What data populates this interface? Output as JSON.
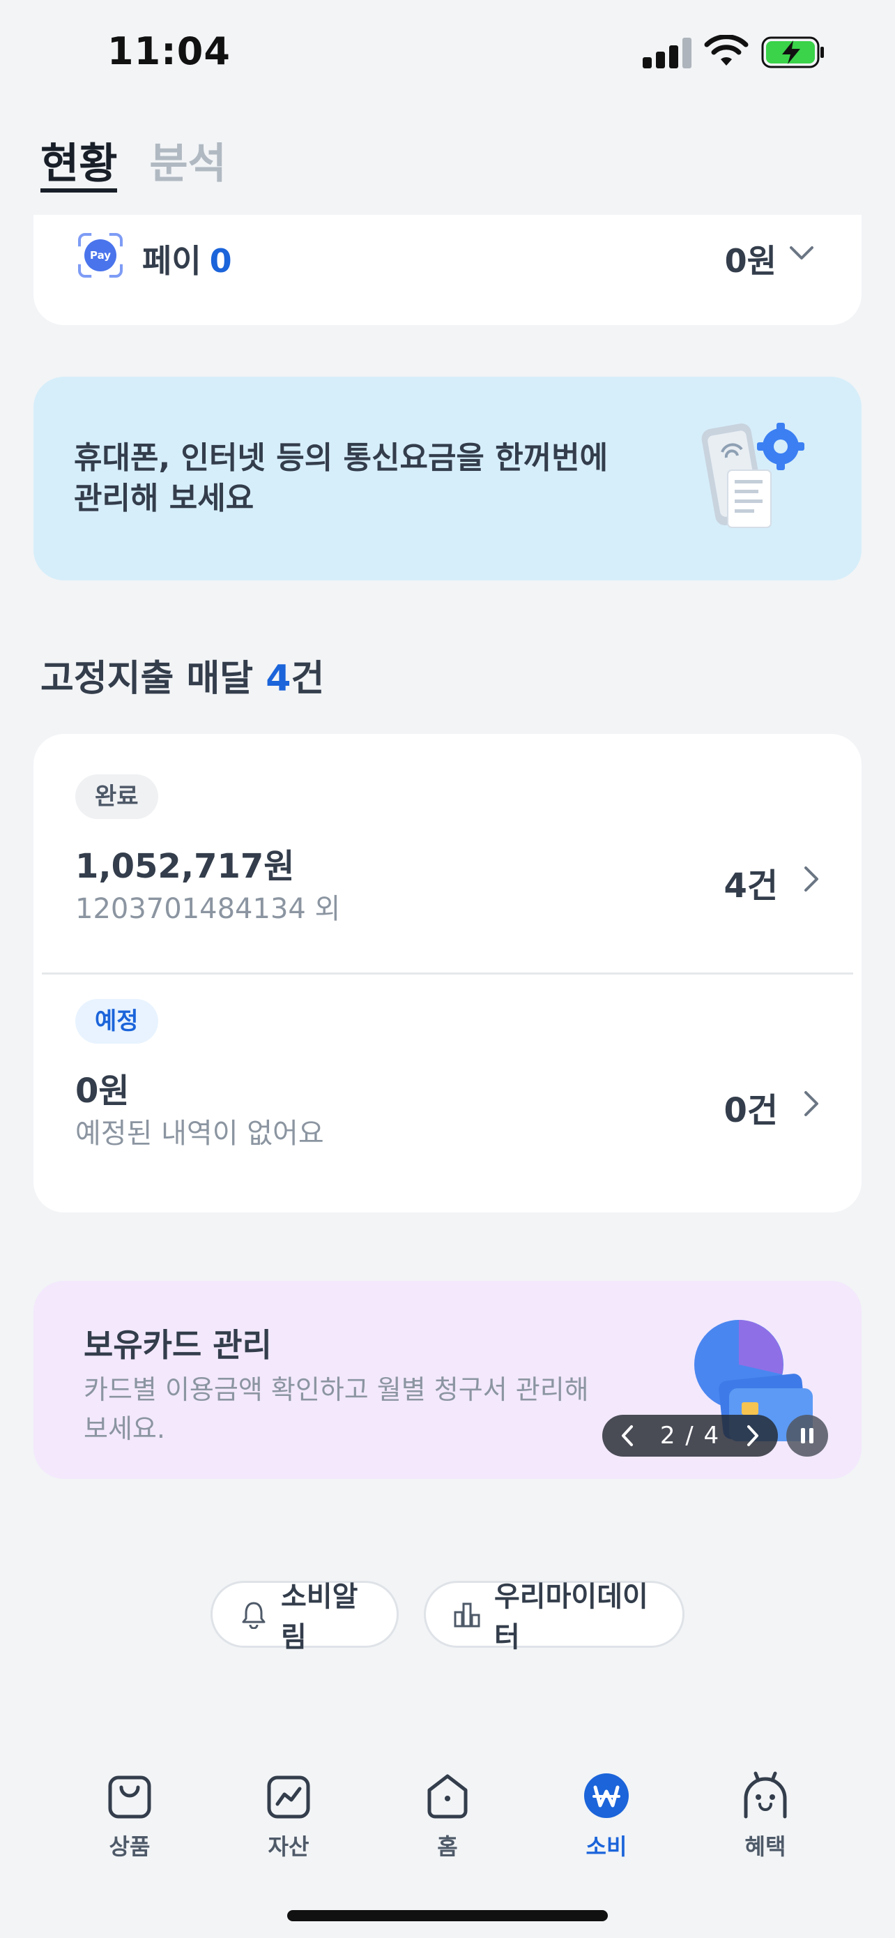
{
  "status_bar": {
    "time": "11:04"
  },
  "tabs": [
    {
      "label": "현황",
      "active": true
    },
    {
      "label": "분석",
      "active": false
    }
  ],
  "pay": {
    "icon_text": "Pay",
    "label": "페이",
    "count": "0",
    "amount": "0원"
  },
  "telecom_banner": {
    "text": "휴대폰, 인터넷 등의 통신요금을 한꺼번에 관리해 보세요"
  },
  "fixed_expense": {
    "title_prefix": "고정지출 매달 ",
    "count": "4",
    "title_suffix": "건",
    "rows": [
      {
        "badge": "완료",
        "amount": "1,052,717원",
        "sub": "1203701484134 외",
        "count": "4건"
      },
      {
        "badge": "예정",
        "amount": "0원",
        "sub": "예정된 내역이 없어요",
        "count": "0건"
      }
    ]
  },
  "card_banner": {
    "title": "보유카드 관리",
    "desc": "카드별 이용금액 확인하고 월별 청구서 관리해 보세요.",
    "pager": "2 / 4"
  },
  "pills": {
    "alert": "소비알림",
    "mydata": "우리마이데이터"
  },
  "bottom_nav": [
    {
      "label": "상품",
      "icon": "shopping-bag-icon",
      "active": false
    },
    {
      "label": "자산",
      "icon": "asset-chart-icon",
      "active": false
    },
    {
      "label": "홈",
      "icon": "home-icon",
      "active": false
    },
    {
      "label": "소비",
      "icon": "won-coin-icon",
      "active": true
    },
    {
      "label": "혜택",
      "icon": "character-icon",
      "active": false
    }
  ],
  "colors": {
    "accent": "#1b64da",
    "background": "#f2f4f6",
    "telecom_banner_bg": "#d6eefa",
    "card_banner_bg": "#f3e8fc"
  }
}
